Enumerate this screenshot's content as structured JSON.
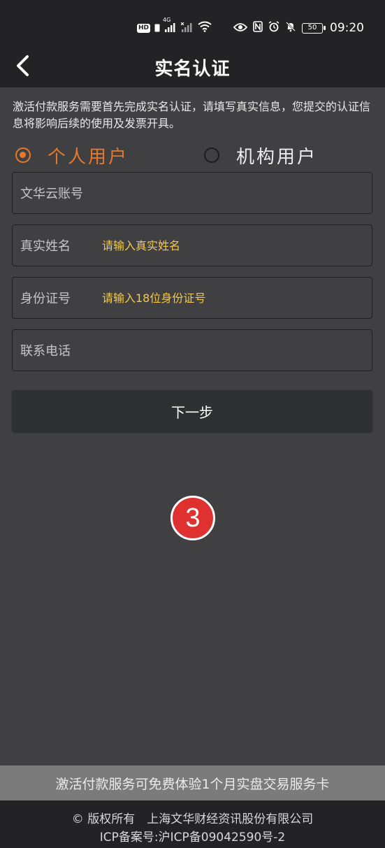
{
  "status_bar": {
    "left_badge": "HD",
    "network": "4G",
    "battery": "50",
    "time": "09:20",
    "icons": [
      "signal-icon",
      "signal-off-icon",
      "wifi-icon",
      "eye-icon",
      "nfc-icon",
      "alarm-icon",
      "mute-icon",
      "battery-icon"
    ]
  },
  "header": {
    "title": "实名认证",
    "back_icon": "chevron-left-icon"
  },
  "intro_text": "激活付款服务需要首先完成实名认证，请填写真实信息，您提交的认证信息将影响后续的使用及发票开具。",
  "user_type": {
    "personal_label": "个人用户",
    "organization_label": "机构用户",
    "selected": "personal"
  },
  "form": {
    "account_label": "文华云账号",
    "account_value": "",
    "name_label": "真实姓名",
    "name_placeholder": "请输入真实姓名",
    "id_label": "身份证号",
    "id_placeholder": "请输入18位身份证号",
    "phone_label": "联系电话",
    "phone_value": ""
  },
  "next_button_label": "下一步",
  "step_badge": "3",
  "promo_text": "激活付款服务可免费体验1个月实盘交易服务卡",
  "footer": {
    "copyright": "© 版权所有　上海文华财经资讯股份有限公司",
    "icp": "ICP备案号:沪ICP备09042590号-2"
  },
  "colors": {
    "accent": "#e5782b",
    "placeholder": "#f4c84a",
    "badge": "#e03131"
  }
}
